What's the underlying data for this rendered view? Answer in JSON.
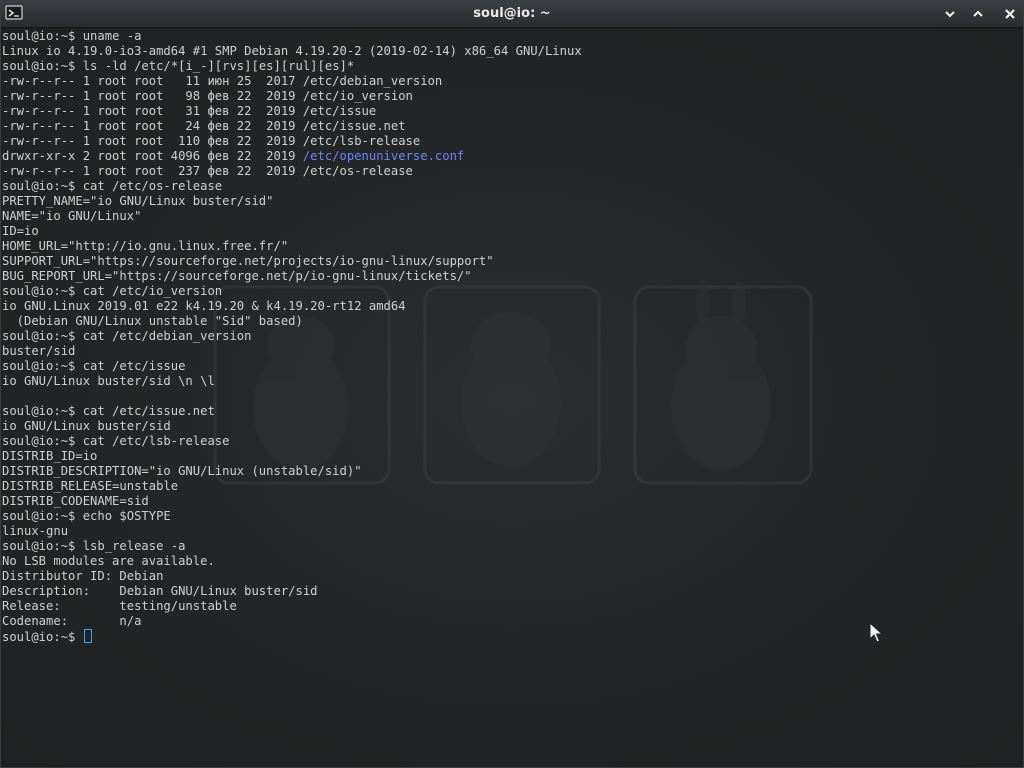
{
  "window": {
    "title": "soul@io: ~",
    "icon": "terminal-icon",
    "controls": [
      "minimize-icon",
      "maximize-icon",
      "close-icon"
    ]
  },
  "colors": {
    "text": "#d0d0d0",
    "directory": "#6b86ff",
    "cursor": "#3aa0ff",
    "background": "#232526"
  },
  "terminal": {
    "prompt": "soul@io:~$ ",
    "lines": [
      {
        "type": "cmd",
        "text": "uname -a"
      },
      {
        "type": "out",
        "text": "Linux io 4.19.0-io3-amd64 #1 SMP Debian 4.19.20-2 (2019-02-14) x86_64 GNU/Linux"
      },
      {
        "type": "cmd",
        "text": "ls -ld /etc/*[i_-][rvs][es][rul][es]*"
      },
      {
        "type": "out",
        "text": "-rw-r--r-- 1 root root   11 июн 25  2017 /etc/debian_version"
      },
      {
        "type": "out",
        "text": "-rw-r--r-- 1 root root   98 фев 22  2019 /etc/io_version"
      },
      {
        "type": "out",
        "text": "-rw-r--r-- 1 root root   31 фев 22  2019 /etc/issue"
      },
      {
        "type": "out",
        "text": "-rw-r--r-- 1 root root   24 фев 22  2019 /etc/issue.net"
      },
      {
        "type": "out",
        "text": "-rw-r--r-- 1 root root  110 фев 22  2019 /etc/lsb-release"
      },
      {
        "type": "dir",
        "text": "drwxr-xr-x 2 root root 4096 фев 22  2019 ",
        "link": "/etc/openuniverse.conf"
      },
      {
        "type": "out",
        "text": "-rw-r--r-- 1 root root  237 фев 22  2019 /etc/os-release"
      },
      {
        "type": "cmd",
        "text": "cat /etc/os-release"
      },
      {
        "type": "out",
        "text": "PRETTY_NAME=\"io GNU/Linux buster/sid\""
      },
      {
        "type": "out",
        "text": "NAME=\"io GNU/Linux\""
      },
      {
        "type": "out",
        "text": "ID=io"
      },
      {
        "type": "out",
        "text": "HOME_URL=\"http://io.gnu.linux.free.fr/\""
      },
      {
        "type": "out",
        "text": "SUPPORT_URL=\"https://sourceforge.net/projects/io-gnu-linux/support\""
      },
      {
        "type": "out",
        "text": "BUG_REPORT_URL=\"https://sourceforge.net/p/io-gnu-linux/tickets/\""
      },
      {
        "type": "cmd",
        "text": "cat /etc/io_version"
      },
      {
        "type": "out",
        "text": "io GNU.Linux 2019.01 e22 k4.19.20 & k4.19.20-rt12 amd64"
      },
      {
        "type": "out",
        "text": "  (Debian GNU/Linux unstable \"Sid\" based)"
      },
      {
        "type": "cmd",
        "text": "cat /etc/debian_version"
      },
      {
        "type": "out",
        "text": "buster/sid"
      },
      {
        "type": "cmd",
        "text": "cat /etc/issue"
      },
      {
        "type": "out",
        "text": "io GNU/Linux buster/sid \\n \\l"
      },
      {
        "type": "out",
        "text": ""
      },
      {
        "type": "cmd",
        "text": "cat /etc/issue.net"
      },
      {
        "type": "out",
        "text": "io GNU/Linux buster/sid"
      },
      {
        "type": "cmd",
        "text": "cat /etc/lsb-release"
      },
      {
        "type": "out",
        "text": "DISTRIB_ID=io"
      },
      {
        "type": "out",
        "text": "DISTRIB_DESCRIPTION=\"io GNU/Linux (unstable/sid)\""
      },
      {
        "type": "out",
        "text": "DISTRIB_RELEASE=unstable"
      },
      {
        "type": "out",
        "text": "DISTRIB_CODENAME=sid"
      },
      {
        "type": "cmd",
        "text": "echo $OSTYPE"
      },
      {
        "type": "out",
        "text": "linux-gnu"
      },
      {
        "type": "cmd",
        "text": "lsb_release -a"
      },
      {
        "type": "out",
        "text": "No LSB modules are available."
      },
      {
        "type": "out",
        "text": "Distributor ID:\tDebian"
      },
      {
        "type": "out",
        "text": "Description:\tDebian GNU/Linux buster/sid"
      },
      {
        "type": "out",
        "text": "Release:\ttesting/unstable"
      },
      {
        "type": "out",
        "text": "Codename:\tn/a"
      },
      {
        "type": "input",
        "text": ""
      }
    ]
  }
}
